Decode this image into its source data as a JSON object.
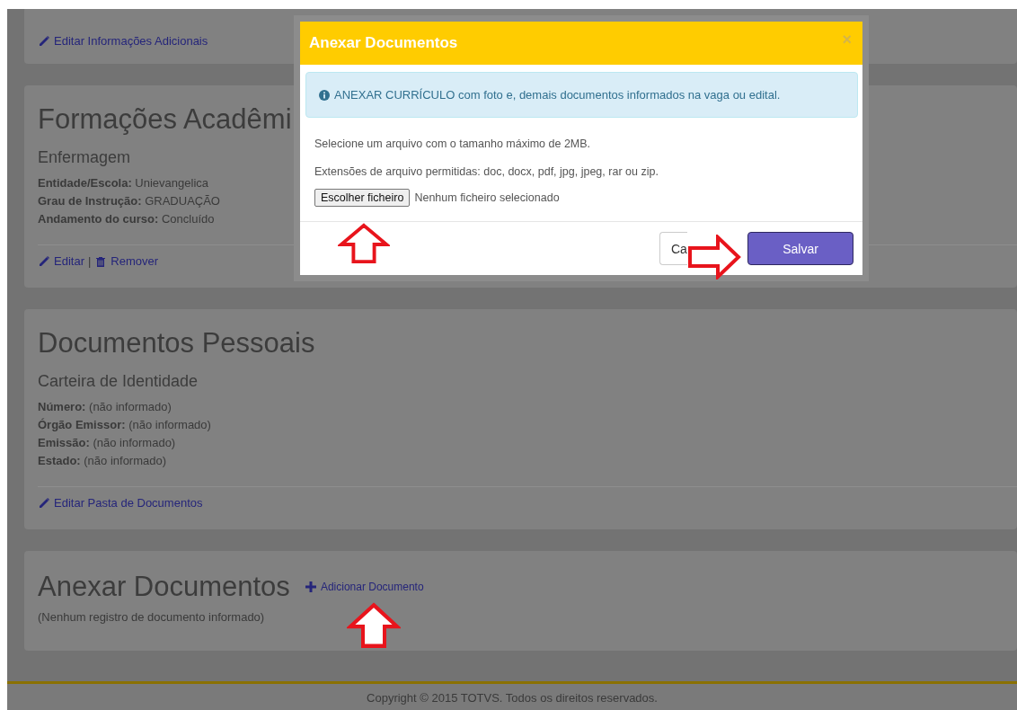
{
  "sections": [
    {
      "kind": "links",
      "links": [
        {
          "kind": "edit",
          "label": "Editar Informações Adicionais"
        }
      ]
    },
    {
      "kind": "record",
      "title": "Formações Acadêmi",
      "subtitle": "Enfermagem",
      "fields": [
        {
          "label": "Entidade/Escola:",
          "value": "Unievangelica"
        },
        {
          "label": "Grau de Instrução:",
          "value": "GRADUAÇÃO"
        },
        {
          "label": "Andamento do curso:",
          "value": "Concluído"
        }
      ],
      "separator": "|",
      "links": [
        {
          "kind": "edit",
          "label": "Editar"
        },
        {
          "kind": "remove",
          "label": "Remover"
        }
      ]
    },
    {
      "kind": "record",
      "title": "Documentos Pessoais",
      "subtitle": "Carteira de Identidade",
      "fields": [
        {
          "label": "Número:",
          "value": "(não informado)"
        },
        {
          "label": "Órgão Emissor:",
          "value": "(não informado)"
        },
        {
          "label": "Emissão:",
          "value": "(não informado)"
        },
        {
          "label": "Estado:",
          "value": "(não informado)"
        }
      ],
      "links": [
        {
          "kind": "edit",
          "label": "Editar Pasta de Documentos"
        }
      ]
    },
    {
      "kind": "attachments",
      "title": "Anexar Documentos",
      "action": {
        "kind": "add",
        "label": "Adicionar Documento"
      },
      "empty_text": "(Nenhum registro de documento informado)"
    }
  ],
  "footer": "Copyright © 2015 TOTVS. Todos os direitos reservados.",
  "modal": {
    "title": "Anexar Documentos",
    "close": "×",
    "alert": "ANEXAR CURRÍCULO com foto e, demais documentos informados na vaga ou edital.",
    "texts": [
      "Selecione um arquivo com o tamanho máximo de 2MB.",
      "Extensões de arquivo permitidas: doc, docx, pdf, jpg, jpeg, rar ou zip."
    ],
    "file_button": "Escolher ficheiro",
    "file_status": "Nenhum ficheiro selecionado",
    "buttons": [
      {
        "kind": "secondary",
        "label": "Ca"
      },
      {
        "kind": "primary",
        "label": "Salvar"
      }
    ]
  },
  "annotations": [
    {
      "kind": "up"
    },
    {
      "kind": "right"
    },
    {
      "kind": "up"
    }
  ]
}
